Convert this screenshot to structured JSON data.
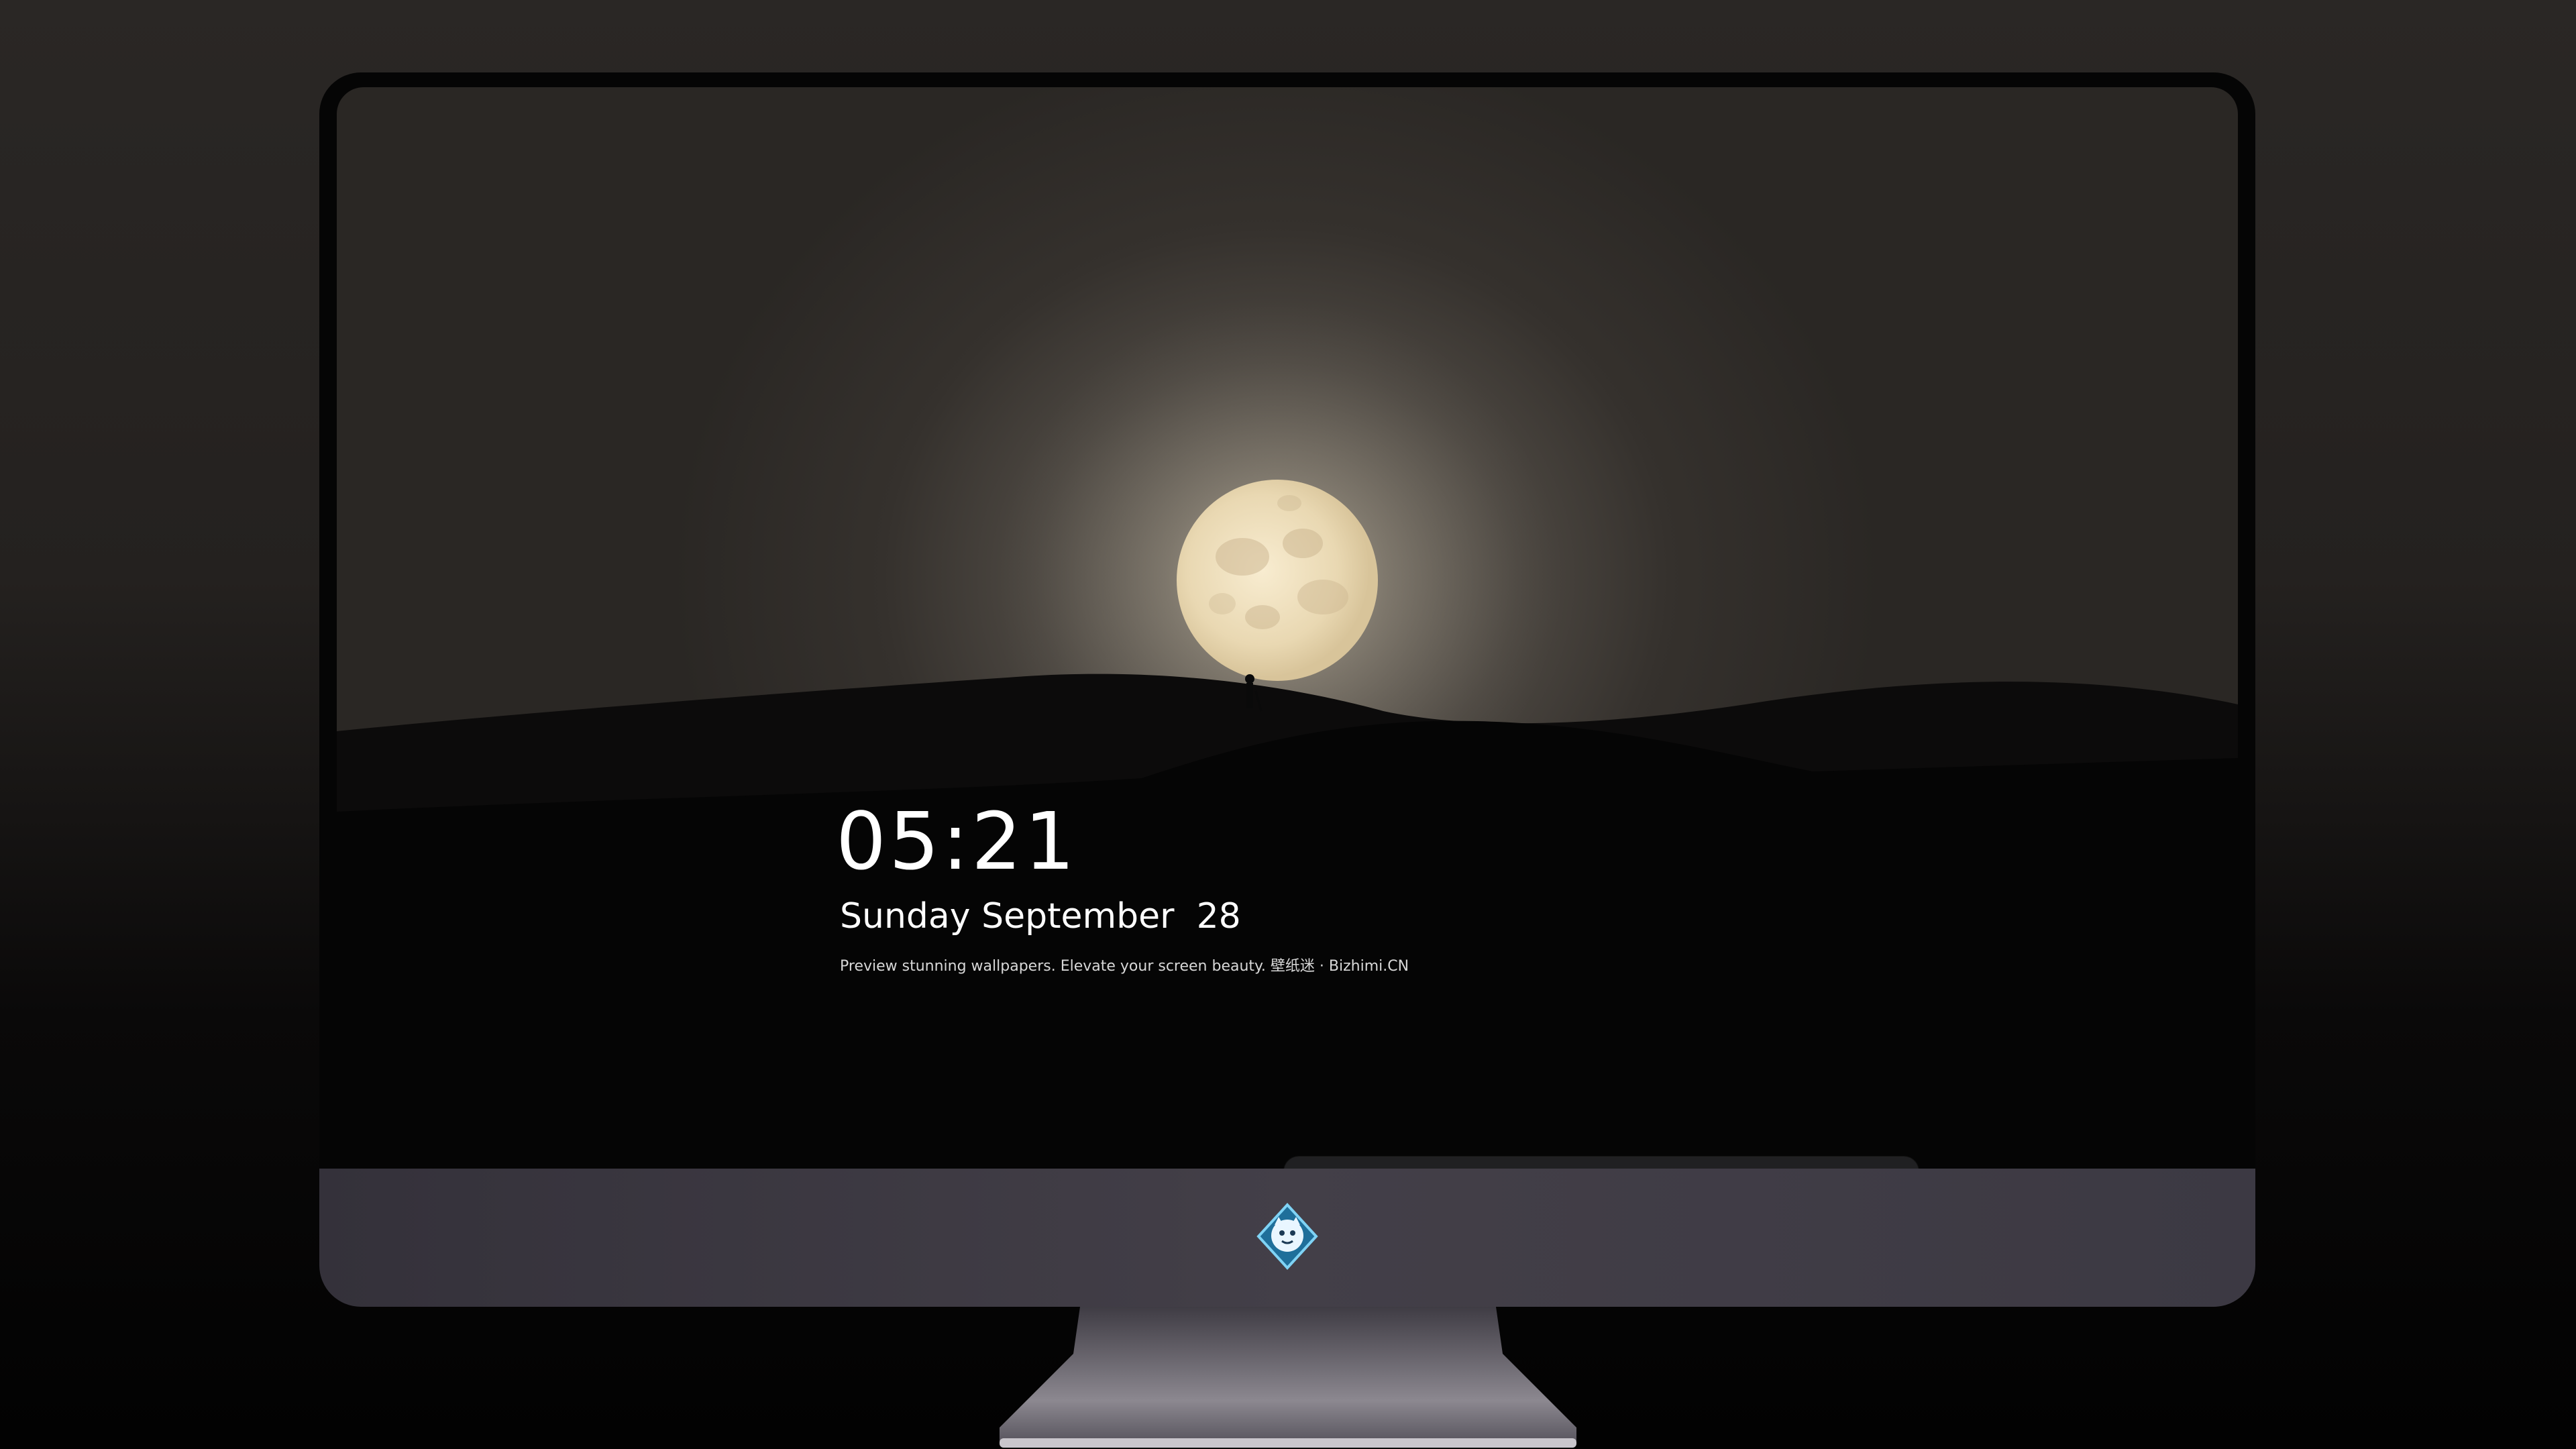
{
  "lock_screen": {
    "time": "05:21",
    "date": "Sunday September  28",
    "caption": "Preview stunning wallpapers. Elevate your screen beauty. 壁纸迷 · Bizhimi.CN"
  },
  "dock": {
    "apps": [
      {
        "icon": "messages-icon",
        "color": "#2bd152"
      },
      {
        "icon": "weather-icon",
        "color": "#2f8ff0"
      },
      {
        "icon": "clock-icon",
        "color": "#ffffff"
      },
      {
        "icon": "preview-icon",
        "color": "#f5c542"
      },
      {
        "icon": "clips-icon",
        "color": "#4fc3e8"
      },
      {
        "icon": "notes-icon",
        "color": "#ffd84a"
      },
      {
        "icon": "photo-booth-icon",
        "color": "#e8e8e8"
      },
      {
        "icon": "itunes-icon",
        "color": "#d23fd8"
      },
      {
        "icon": "app-store-icon",
        "color": "#1e8ef7"
      },
      {
        "icon": "camera-icon",
        "color": "#8a8a8a"
      }
    ]
  },
  "colors": {
    "sky_glow": "#8e877b",
    "moon": "#f1e2c0",
    "chin": "#433f48"
  }
}
